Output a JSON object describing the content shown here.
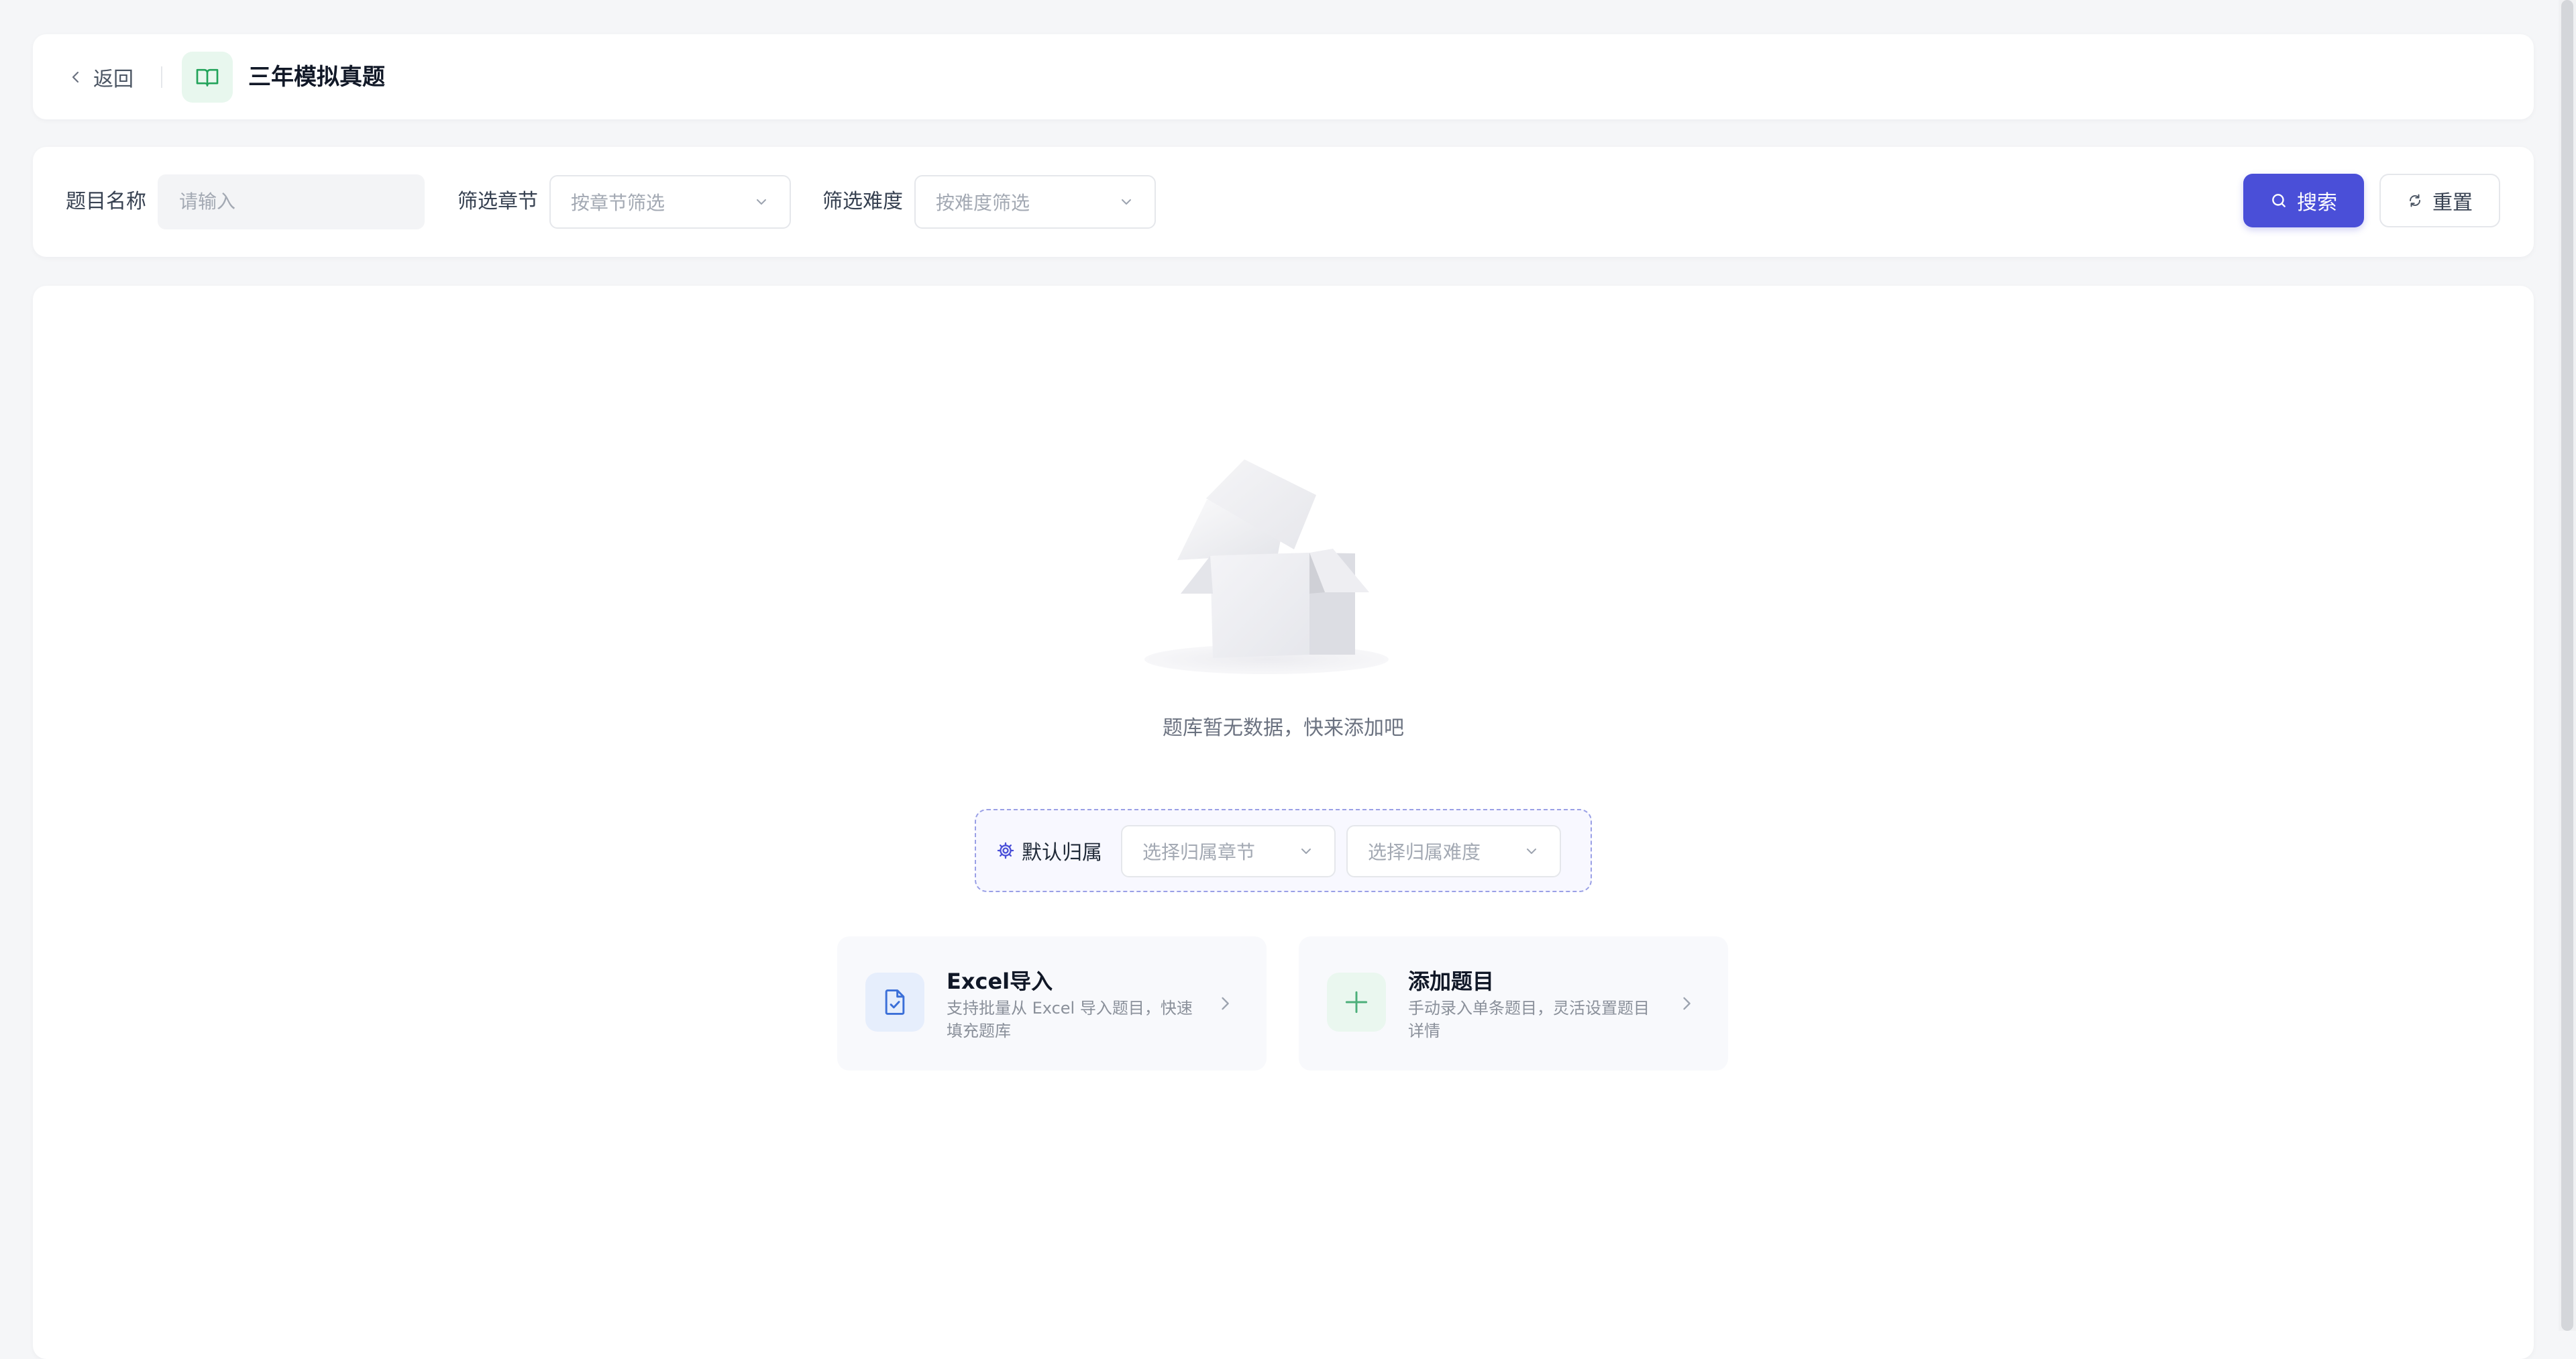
{
  "header": {
    "back_label": "返回",
    "title": "三年模拟真题"
  },
  "filters": {
    "name_label": "题目名称",
    "name_placeholder": "请输入",
    "chapter_label": "筛选章节",
    "chapter_placeholder": "按章节筛选",
    "difficulty_label": "筛选难度",
    "difficulty_placeholder": "按难度筛选",
    "search_label": "搜索",
    "reset_label": "重置"
  },
  "empty": {
    "message": "题库暂无数据，快来添加吧"
  },
  "defaults": {
    "label": "默认归属",
    "chapter_placeholder": "选择归属章节",
    "difficulty_placeholder": "选择归属难度"
  },
  "actions": [
    {
      "title": "Excel导入",
      "description": "支持批量从 Excel 导入题目，快速填充题库",
      "icon": "file-check-icon"
    },
    {
      "title": "添加题目",
      "description": "手动录入单条题目，灵活设置题目详情",
      "icon": "plus-icon"
    }
  ],
  "colors": {
    "primary": "#4a4fd8",
    "book_icon": "#22a35a",
    "excel_icon": "#3b6fd8",
    "add_icon": "#4caf7a"
  }
}
